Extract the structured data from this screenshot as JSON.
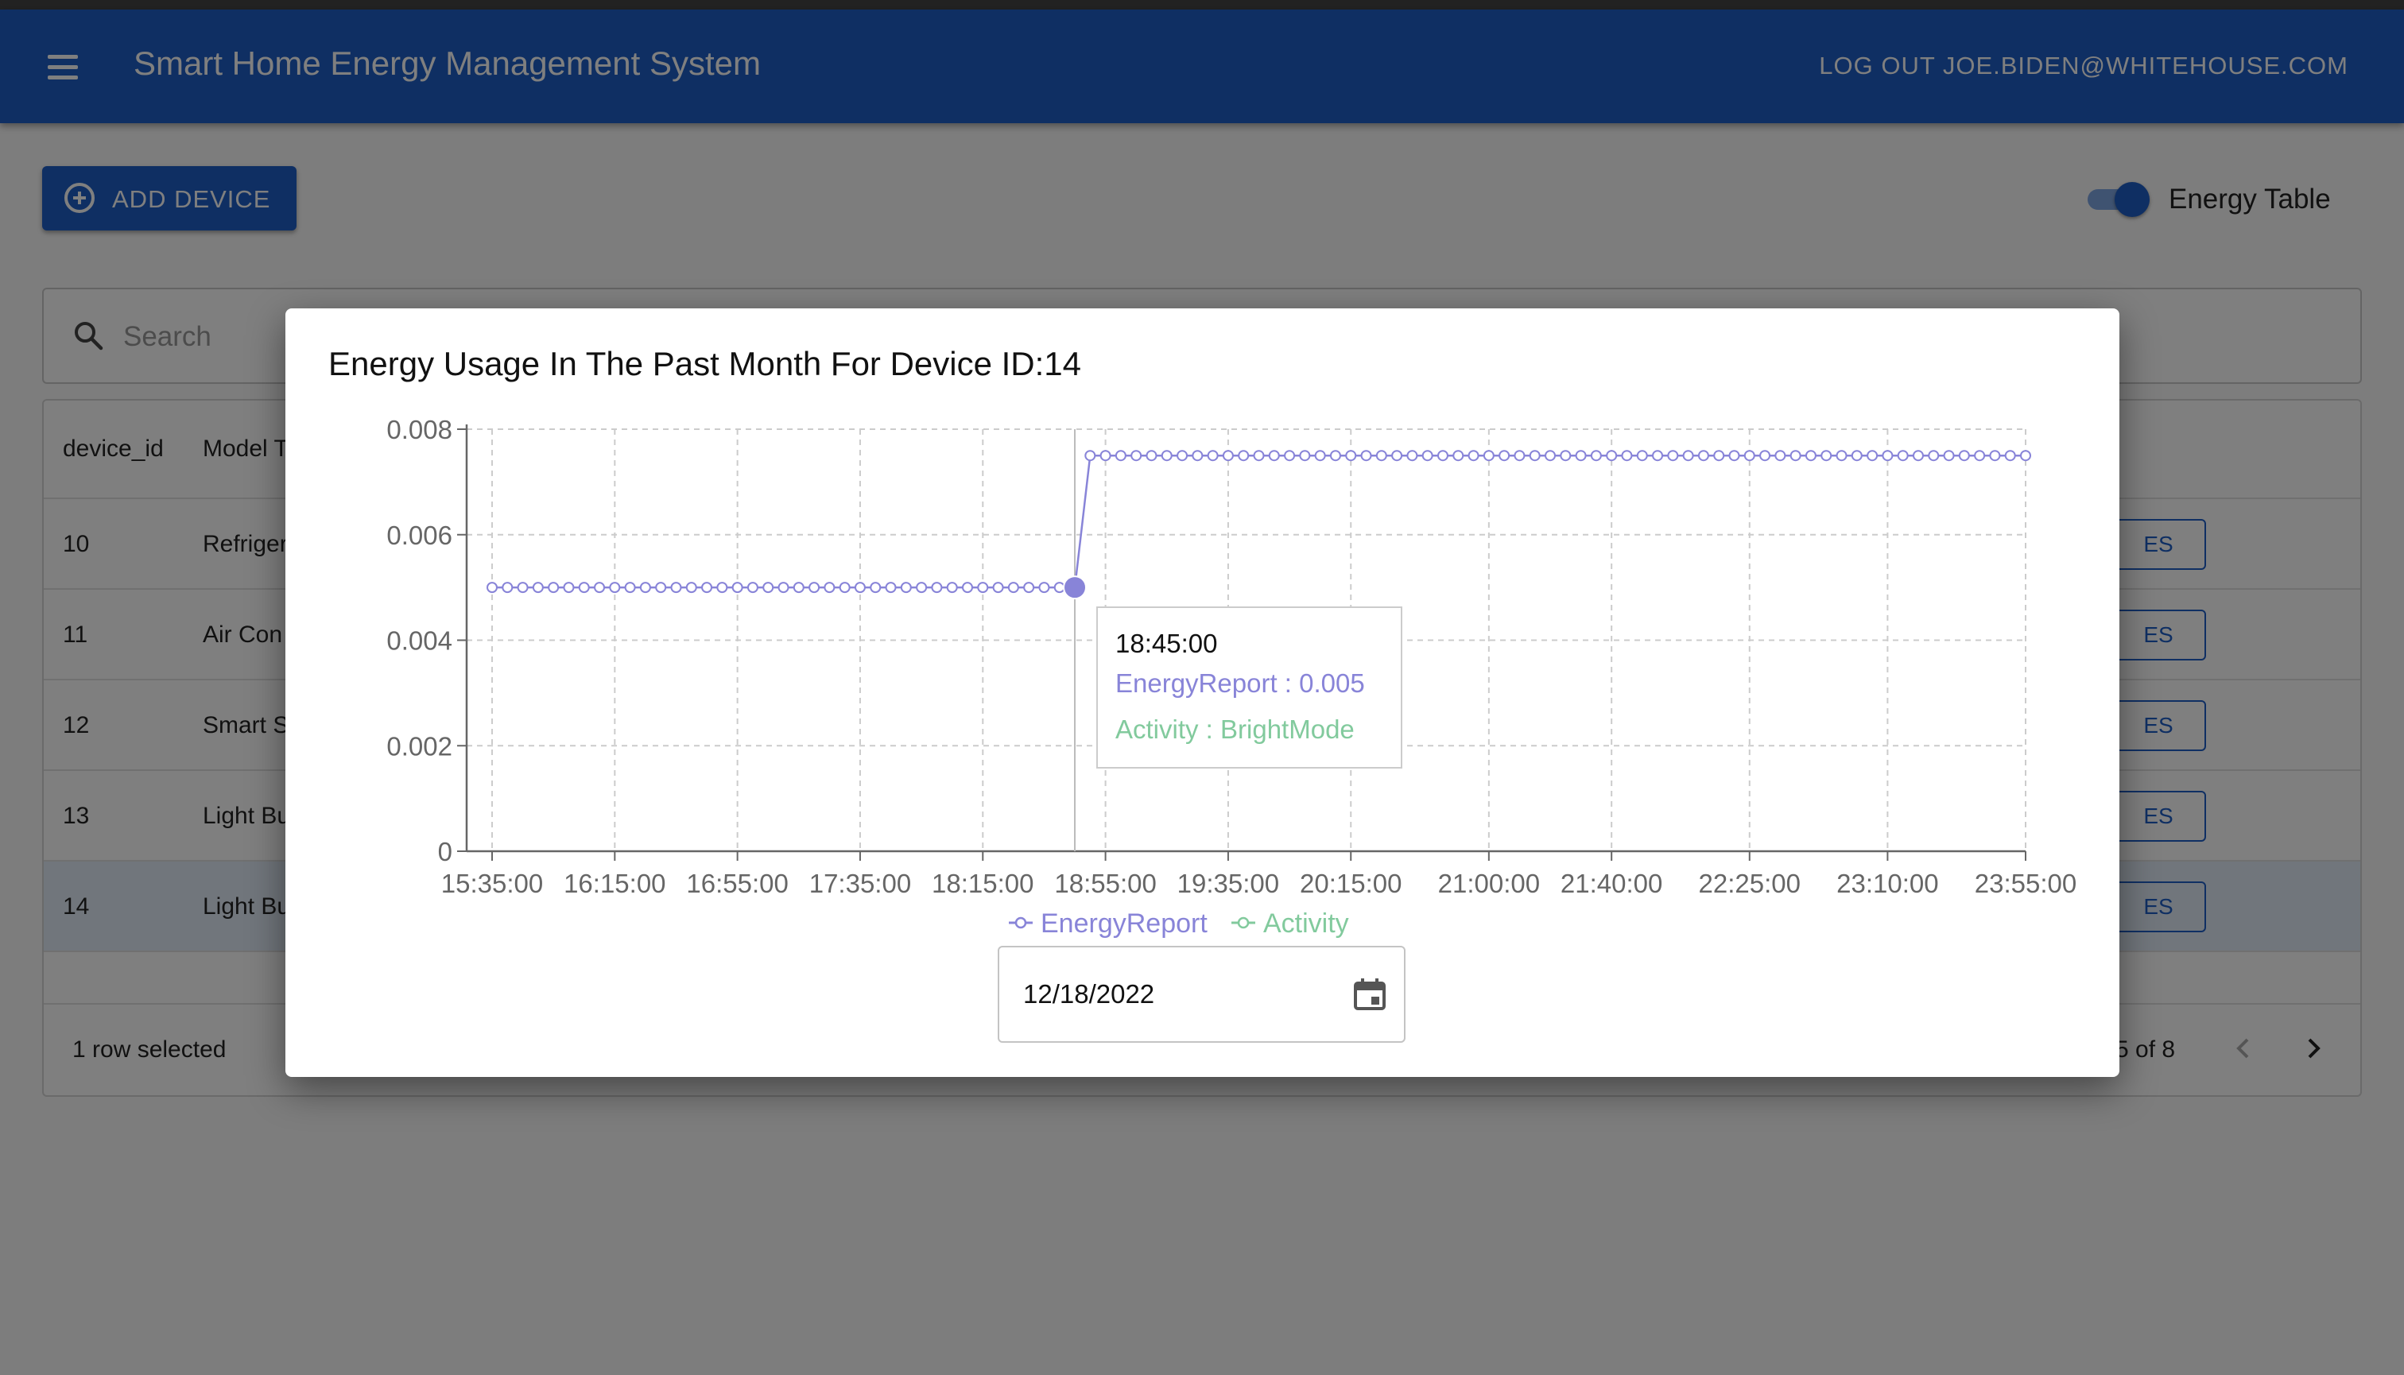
{
  "app": {
    "title": "Smart Home Energy Management System",
    "logout_label": "LOG OUT JOE.BIDEN@WHITEHOUSE.COM"
  },
  "toolbar": {
    "add_device_label": "ADD DEVICE",
    "energy_table_label": "Energy Table",
    "energy_table_on": true
  },
  "search": {
    "placeholder": "Search"
  },
  "table": {
    "columns": [
      "device_id",
      "Model T"
    ],
    "rows": [
      {
        "device_id": "10",
        "model": "Refriger",
        "action": "ES"
      },
      {
        "device_id": "11",
        "model": "Air Con",
        "action": "ES"
      },
      {
        "device_id": "12",
        "model": "Smart S",
        "action": "ES"
      },
      {
        "device_id": "13",
        "model": "Light Bu",
        "action": "ES"
      },
      {
        "device_id": "14",
        "model": "Light Bu",
        "action": "ES"
      }
    ],
    "selected_row": 4,
    "footer": {
      "selected_text": "1 row selected",
      "pagination_text": "5 of 8"
    }
  },
  "modal": {
    "title": "Energy Usage In The Past Month For Device ID:14",
    "tooltip": {
      "time": "18:45:00",
      "energy_text": "EnergyReport : 0.005",
      "activity_text": "Activity : BrightMode"
    },
    "date_value": "12/18/2022"
  },
  "colors": {
    "primary": "#1e5fc7",
    "energy_series": "#8884d8",
    "activity_series": "#82ca9d"
  },
  "chart_data": {
    "type": "line",
    "title": "Energy Usage In The Past Month For Device ID:14",
    "xlabel": "",
    "ylabel": "",
    "x_start": "15:35:00",
    "x_end": "23:55:00",
    "interval_minutes": 5,
    "x_ticks": [
      "15:35:00",
      "16:15:00",
      "16:55:00",
      "17:35:00",
      "18:15:00",
      "18:55:00",
      "19:35:00",
      "20:15:00",
      "21:00:00",
      "21:40:00",
      "22:25:00",
      "23:10:00",
      "23:55:00"
    ],
    "ylim": [
      0,
      0.008
    ],
    "y_ticks": [
      "0",
      "0.002",
      "0.004",
      "0.006",
      "0.008"
    ],
    "grid": true,
    "legend_position": "bottom-center",
    "series": [
      {
        "name": "EnergyReport",
        "color": "#8884d8",
        "segments": [
          {
            "from": "15:35:00",
            "to": "18:45:00",
            "value": 0.005
          },
          {
            "from": "18:50:00",
            "to": "23:55:00",
            "value": 0.0075
          }
        ]
      },
      {
        "name": "Activity",
        "color": "#82ca9d",
        "segments": []
      }
    ],
    "active_point": {
      "x": "18:45:00",
      "value": 0.005
    }
  }
}
